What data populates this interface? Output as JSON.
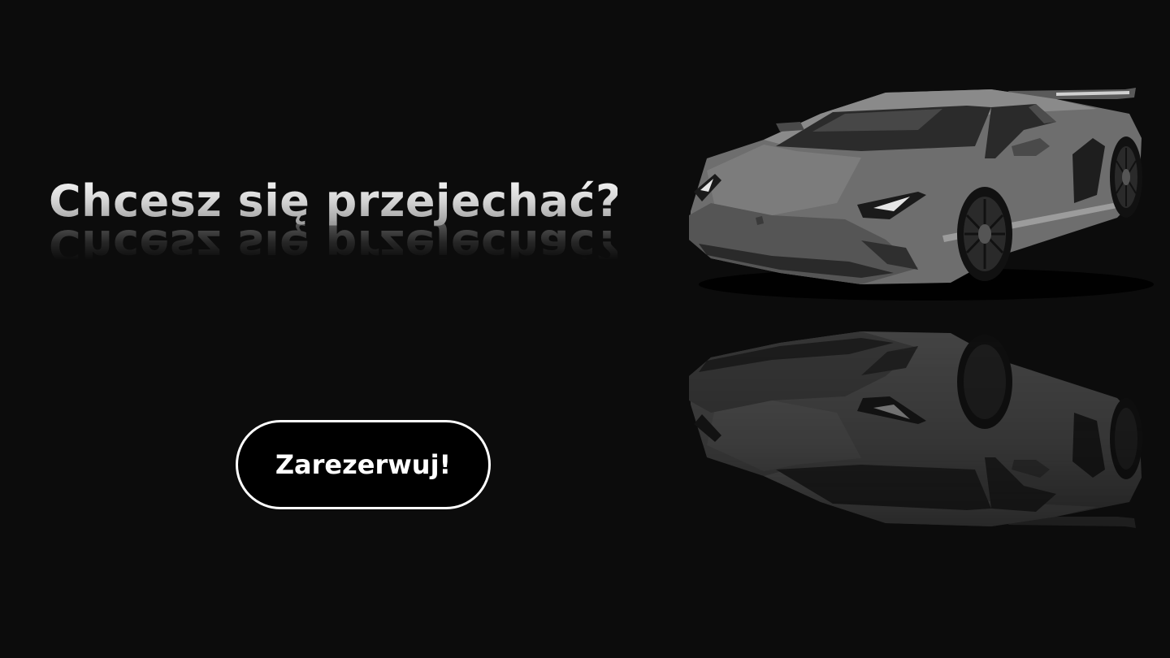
{
  "hero": {
    "headline": "Chcesz się przejechać?",
    "cta_label": "Zarezerwuj!"
  },
  "illustration": {
    "icon": "sports-car-icon"
  },
  "colors": {
    "background": "#0c0c0c",
    "button_background": "#000000",
    "button_border": "#ffffff",
    "text": "#ffffff"
  }
}
